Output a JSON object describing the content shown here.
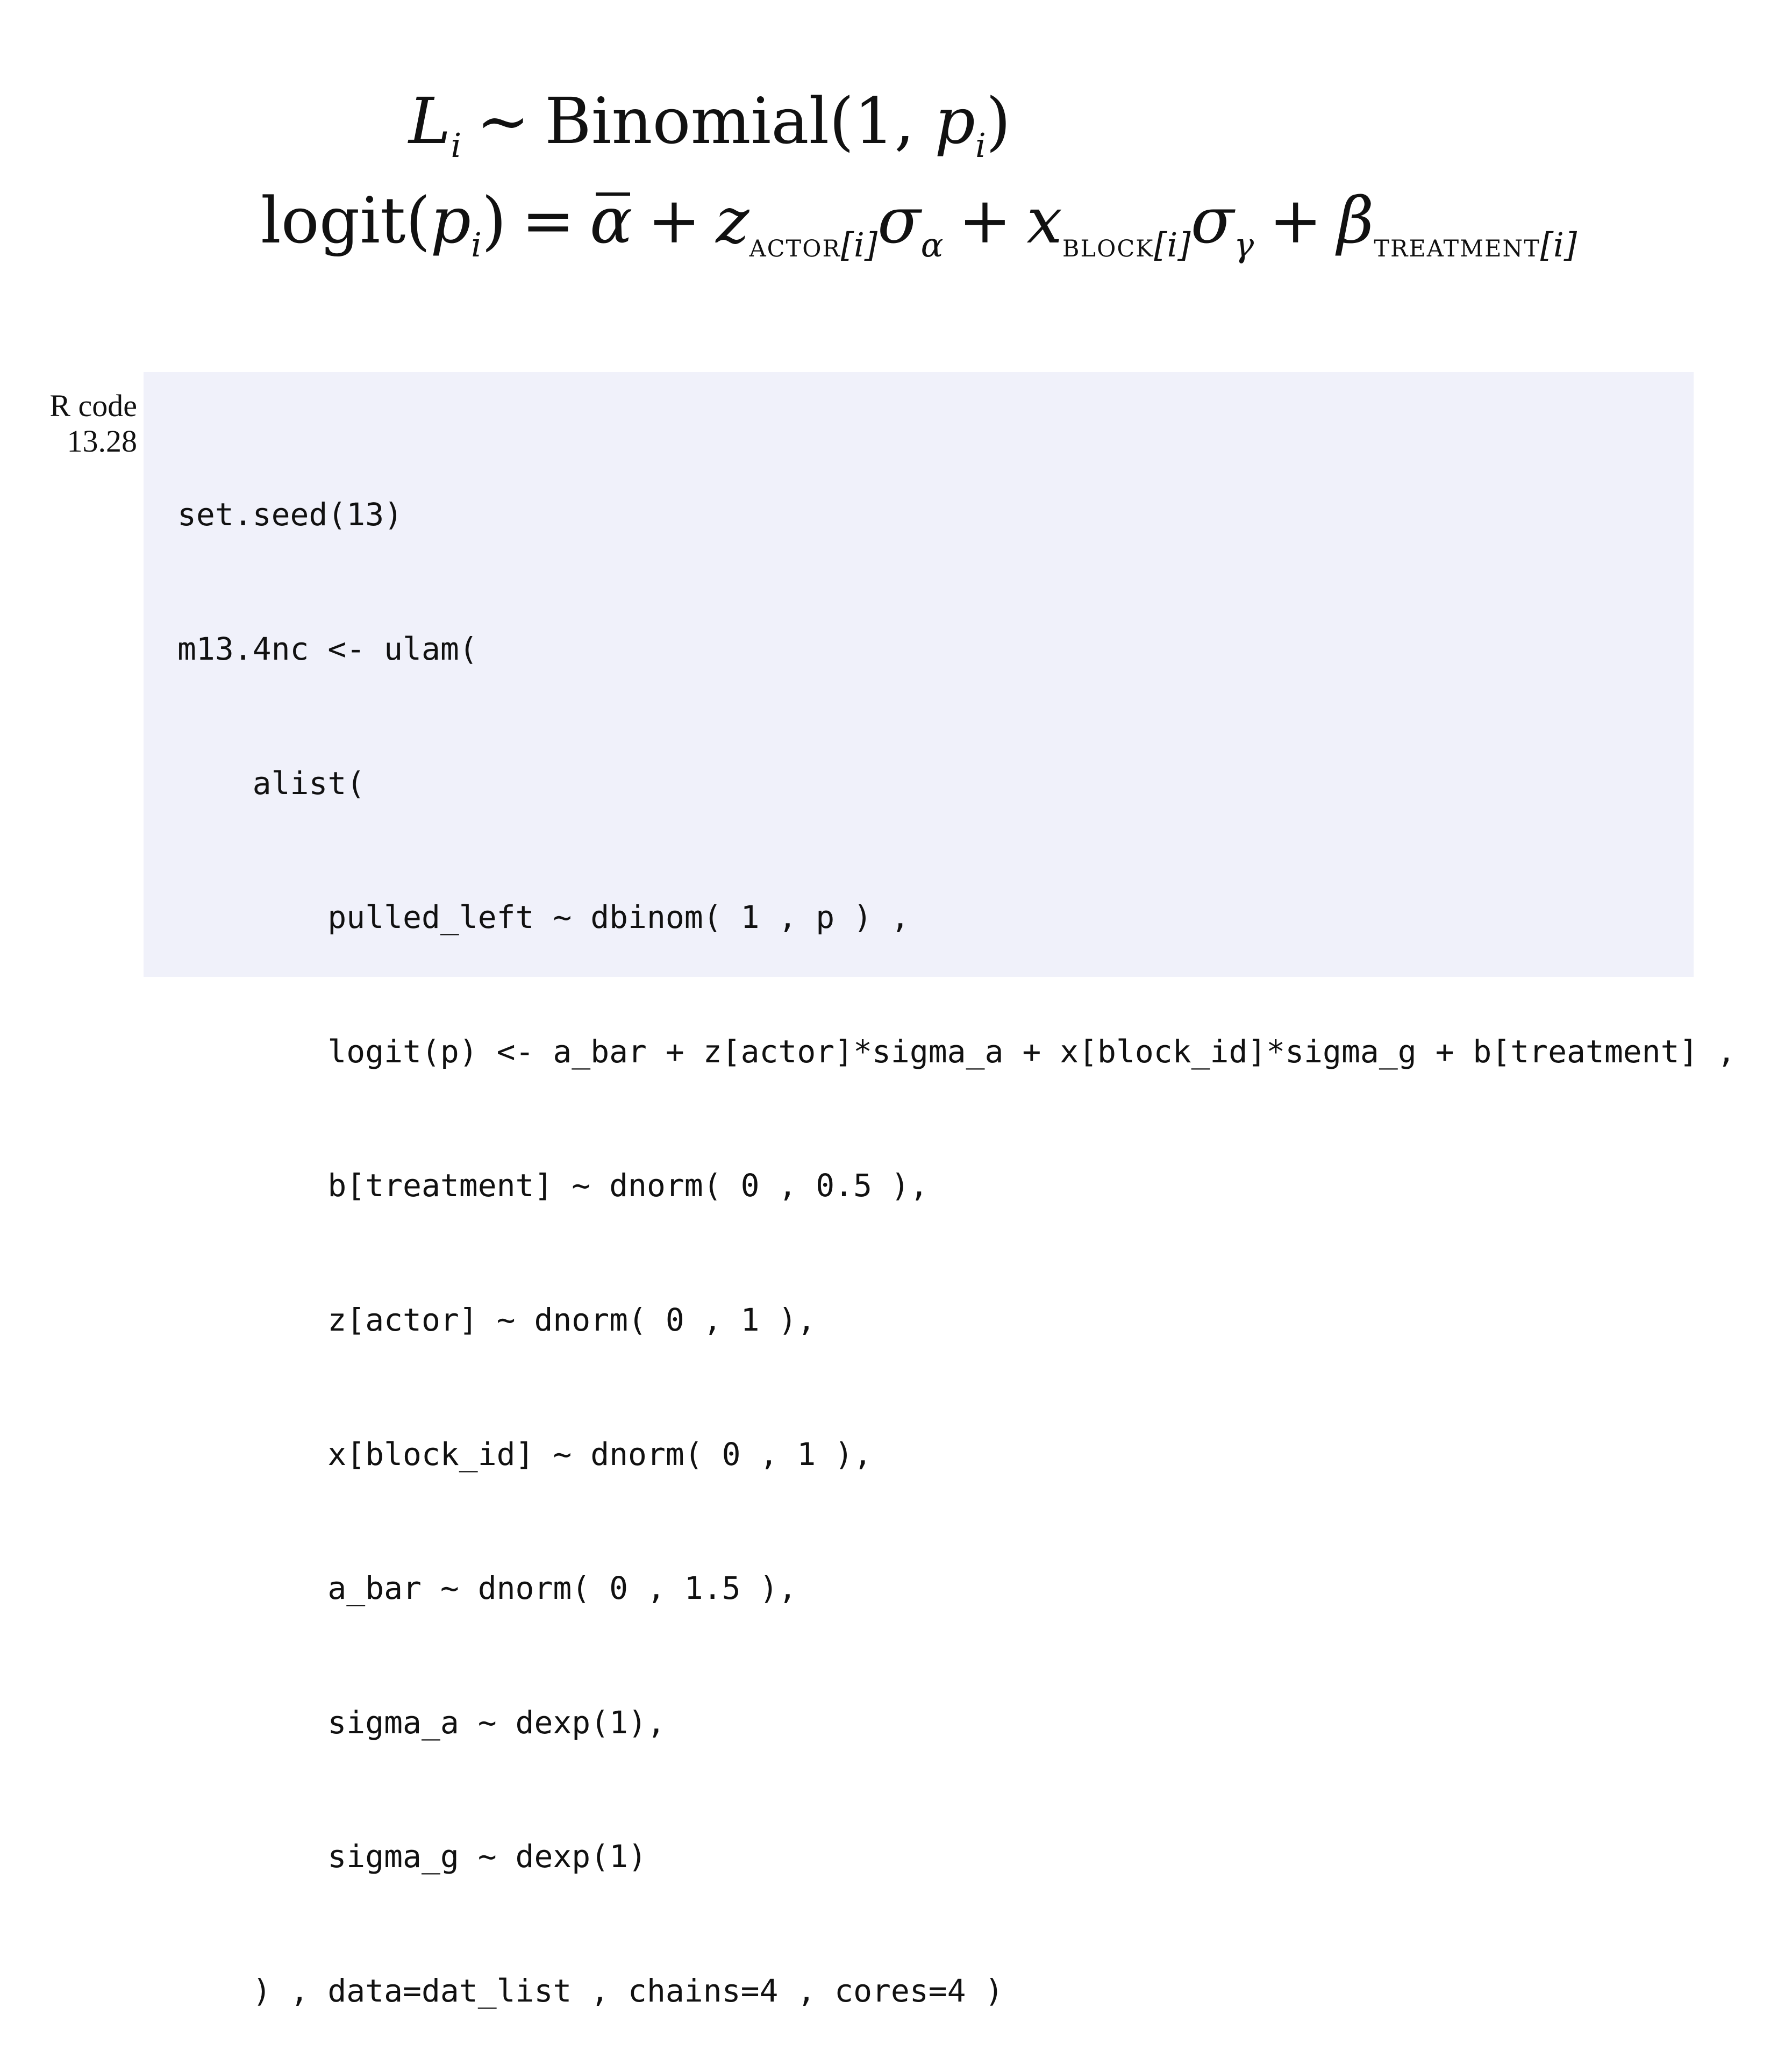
{
  "equations": {
    "eq1": {
      "lhs_var": "L",
      "lhs_sub": "i",
      "tilde": "∼",
      "dist": "Binomial(1, ",
      "p_var": "p",
      "p_sub": "i",
      "close": ")"
    },
    "eq2": {
      "logit": "logit(",
      "p_var": "p",
      "p_sub": "i",
      "close": ")",
      "equals": "=",
      "alpha": "α",
      "plus1": "+",
      "z": "z",
      "z_sub": "actor",
      "z_idx": "[i]",
      "sigma1": "σ",
      "sigma1_sub": "α",
      "plus2": "+",
      "x": "x",
      "x_sub": "block",
      "x_idx": "[i]",
      "sigma2": "σ",
      "sigma2_sub": "γ",
      "plus3": "+",
      "beta": "β",
      "beta_sub": "treatment",
      "beta_idx": "[i]"
    }
  },
  "code_block": {
    "label_line1": "R code",
    "label_line2": "13.28",
    "lines": [
      "set.seed(13)",
      "m13.4nc <- ulam(",
      "    alist(",
      "        pulled_left ~ dbinom( 1 , p ) ,",
      "        logit(p) <- a_bar + z[actor]*sigma_a + x[block_id]*sigma_g + b[treatment] ,",
      "        b[treatment] ~ dnorm( 0 , 0.5 ),",
      "        z[actor] ~ dnorm( 0 , 1 ),",
      "        x[block_id] ~ dnorm( 0 , 1 ),",
      "        a_bar ~ dnorm( 0 , 1.5 ),",
      "        sigma_a ~ dexp(1),",
      "        sigma_g ~ dexp(1)",
      "    ) , data=dat_list , chains=4 , cores=4 )"
    ]
  }
}
